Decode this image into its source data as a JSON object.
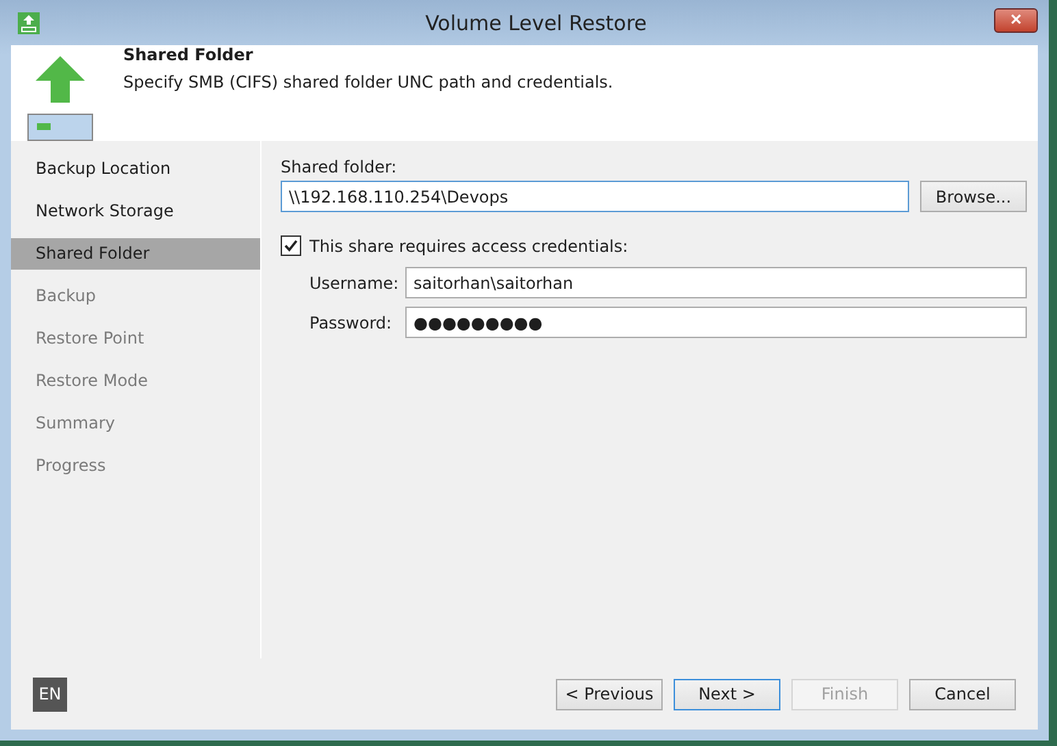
{
  "window": {
    "title": "Volume Level Restore",
    "close": "✕"
  },
  "header": {
    "title": "Shared Folder",
    "description": "Specify SMB (CIFS) shared folder UNC path and credentials."
  },
  "sidebar": {
    "items": [
      {
        "label": "Backup Location",
        "selected": false,
        "disabled": false
      },
      {
        "label": "Network Storage",
        "selected": false,
        "disabled": false
      },
      {
        "label": "Shared Folder",
        "selected": true,
        "disabled": false
      },
      {
        "label": "Backup",
        "selected": false,
        "disabled": true
      },
      {
        "label": "Restore Point",
        "selected": false,
        "disabled": true
      },
      {
        "label": "Restore Mode",
        "selected": false,
        "disabled": true
      },
      {
        "label": "Summary",
        "selected": false,
        "disabled": true
      },
      {
        "label": "Progress",
        "selected": false,
        "disabled": true
      }
    ]
  },
  "form": {
    "shared_folder_label": "Shared folder:",
    "shared_folder": "\\\\192.168.110.254\\Devops",
    "browse": "Browse...",
    "credentials": {
      "label": "This share requires access credentials:",
      "checked": true
    },
    "username_label": "Username:",
    "username": "saitorhan\\saitorhan",
    "password_label": "Password:",
    "password": "●●●●●●●●●"
  },
  "footer": {
    "language": "EN",
    "buttons": [
      {
        "label": "< Previous",
        "disabled": false,
        "default": false
      },
      {
        "label": "Next >",
        "disabled": false,
        "default": true
      },
      {
        "label": "Finish",
        "disabled": true,
        "default": false
      },
      {
        "label": "Cancel",
        "disabled": false,
        "default": false
      }
    ]
  }
}
